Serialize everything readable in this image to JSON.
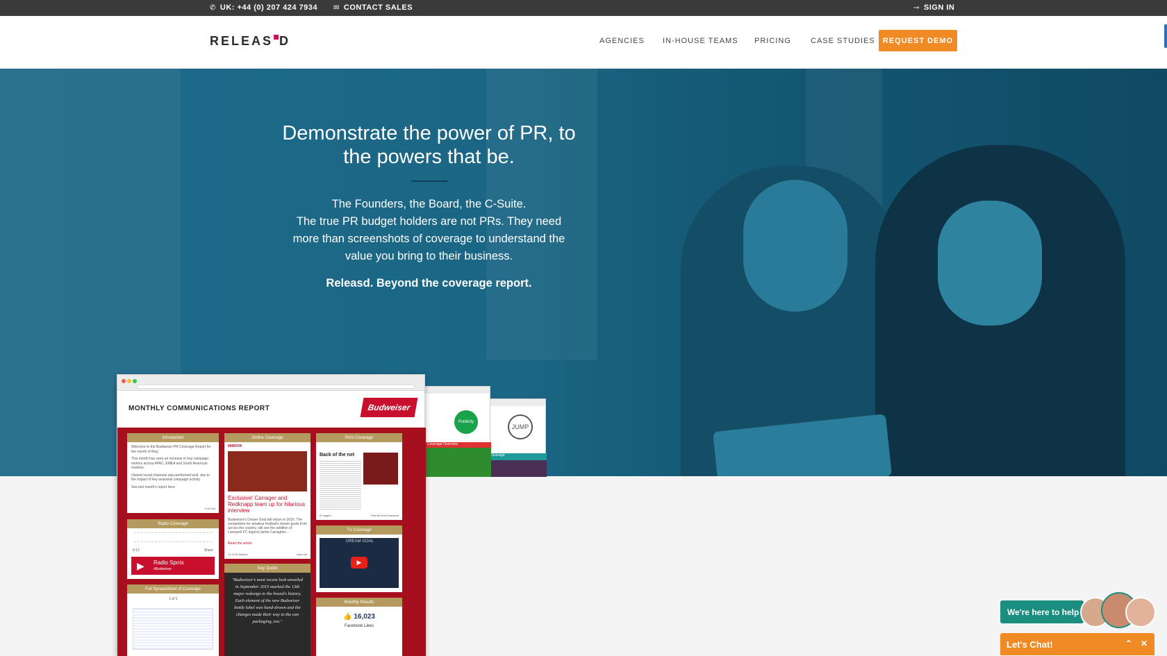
{
  "topbar": {
    "phone_icon": "phone-icon",
    "phone": "UK: +44 (0) 207 424 7934",
    "mail_icon": "mail-icon",
    "contact": "CONTACT SALES",
    "signin_icon": "key-icon",
    "signin": "SIGN IN"
  },
  "nav": {
    "logo": "RELEAS",
    "logo_end": "D",
    "items": [
      "AGENCIES",
      "IN-HOUSE TEAMS",
      "PRICING",
      "CASE STUDIES"
    ],
    "cta": "REQUEST DEMO",
    "accent": "#f08a24"
  },
  "hero": {
    "title_line1": "Demonstrate the power of PR, to",
    "title_line2": "the powers that be.",
    "body_line1": "The Founders, the Board, the C-Suite.",
    "body_line2": "The true PR budget holders are not PRs. They need",
    "body_line3": "more than screenshots of coverage to understand the",
    "body_line4": "value you bring to their business.",
    "tagline": "Releasd. Beyond the coverage report.",
    "bg_color": "#1d5f7c"
  },
  "report": {
    "title": "MONTHLY COMMUNICATIONS REPORT",
    "brand": "Budweiser",
    "cards": {
      "intro": "Introduction",
      "intro_text1": "Welcome to the Budweiser PR Coverage Report for the month of May.",
      "intro_text2": "This month has seen an increase in key campaign metrics across APAC, EMEA and South American markets.",
      "intro_text3": "Owned social channels also performed well, due to the impact of key seasonal campaign activity.",
      "intro_text4": "See last month's report here.",
      "intro_foot": "Full Text",
      "online": "Online Coverage",
      "online_source": "MIRROR",
      "online_headline": "Exclusive! Carrager and Redknapp team up for hilarious interview",
      "online_text": "Budweiser's Dream Goal will return in 2016. The competition for amateur football's dream goals from across the country, will see the addition of Liverpool FC legend Jamie Carragher...",
      "online_link": "Read the article",
      "online_count": "12 of 26 Articles",
      "online_open": "Open All",
      "print": "Print Coverage",
      "print_headline": "Back of the net",
      "print_count": "8 Images",
      "print_view": "View All and Download",
      "radio": "Radio Coverage",
      "radio_time": "6:12",
      "radio_share": "Share",
      "radio_spots": "Radio Spots",
      "radio_tag": "#Budweiser",
      "tv": "TV Coverage",
      "tv_banner": "DREAM GOAL",
      "quote": "Key Quote",
      "quote_text": "\"Budweiser's most recent look unveiled in September 2015 marked the 13th major redesign in the brand's history. Each element of the new Budweiser bottle label was hand-drawn and the changes made their way to the can packaging, too.\"",
      "sheet": "Full Spreadsheet of Coverage",
      "sheet_page": "1 of 1",
      "results": "Monthly Results",
      "likes": "16,023",
      "likes_label": "Facebook Likes"
    },
    "mock2_badge": "Publicity",
    "mock2_label": "Coverage Overview",
    "mock3_logo": "JUMP",
    "mock3_label": "Coverage"
  },
  "chat": {
    "help": "We're here to help",
    "cta": "Let's Chat!",
    "expand_icon": "chevron-up-icon",
    "close_icon": "close-icon"
  }
}
